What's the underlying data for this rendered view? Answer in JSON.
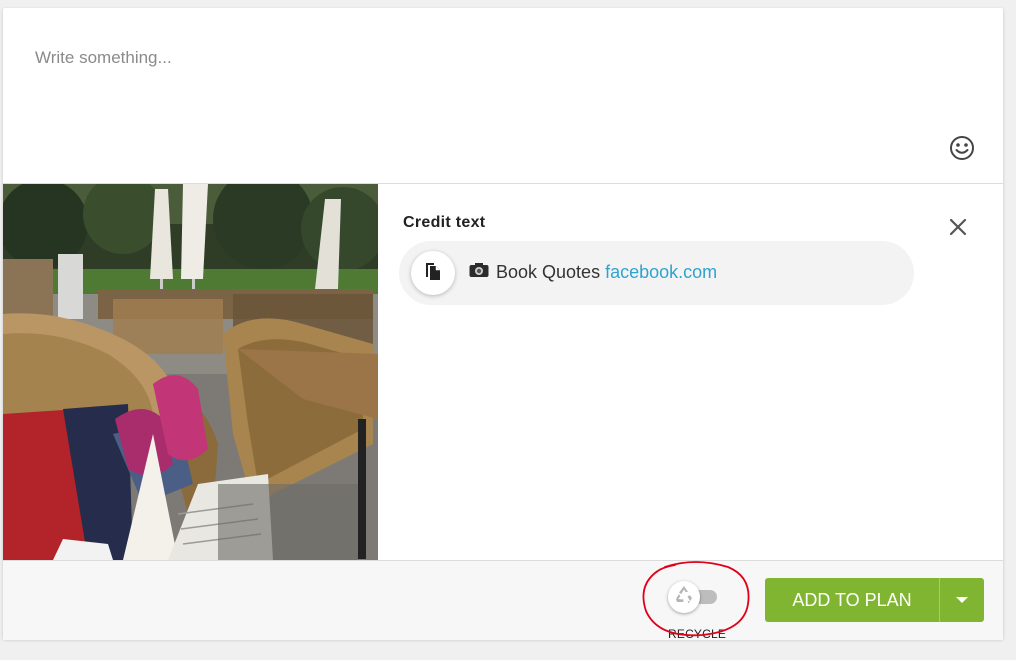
{
  "composer": {
    "placeholder": "Write something..."
  },
  "credit": {
    "title": "Credit text",
    "text": "Book Quotes",
    "link": "facebook.com"
  },
  "footer": {
    "recycle_label": "RECYCLE",
    "add_to_plan_label": "ADD TO PLAN"
  },
  "colors": {
    "accent_green": "#80b532",
    "link_blue": "#2fa3cf",
    "annotation_red": "#e0001a"
  },
  "icons": {
    "emoji": "smiley-icon",
    "close": "close-icon",
    "copy": "copy-icon",
    "camera": "camera-icon",
    "recycle": "recycle-icon",
    "dropdown": "caret-down-icon"
  }
}
